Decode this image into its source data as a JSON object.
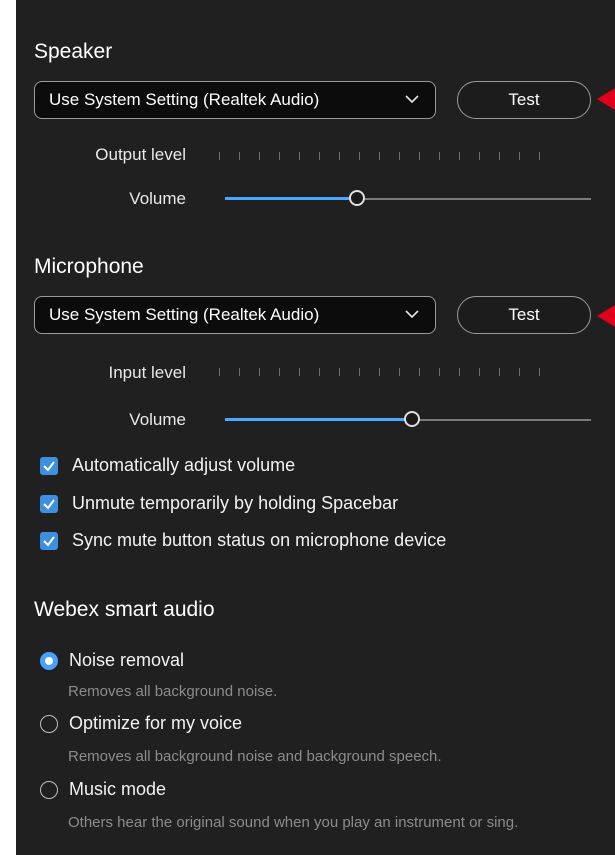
{
  "speaker": {
    "title": "Speaker",
    "device": "Use System Setting (Realtek Audio)",
    "test_label": "Test",
    "output_level_label": "Output level",
    "volume_label": "Volume",
    "volume_fraction": 0.36
  },
  "microphone": {
    "title": "Microphone",
    "device": "Use System Setting (Realtek Audio)",
    "test_label": "Test",
    "input_level_label": "Input level",
    "volume_label": "Volume",
    "volume_fraction": 0.51
  },
  "mic_options": [
    {
      "label": "Automatically adjust volume",
      "checked": true
    },
    {
      "label": "Unmute temporarily by holding Spacebar",
      "checked": true
    },
    {
      "label": "Sync mute button status on microphone device",
      "checked": true
    }
  ],
  "smart_audio": {
    "title": "Webex smart audio",
    "options": [
      {
        "label": "Noise removal",
        "description": "Removes all background noise.",
        "selected": true
      },
      {
        "label": "Optimize for my voice",
        "description": "Removes all background noise and background speech.",
        "selected": false
      },
      {
        "label": "Music mode",
        "description": "Others hear the original sound when you play an instrument or sing.",
        "selected": false
      }
    ]
  },
  "colors": {
    "accent": "#4aa0ff",
    "annotation_arrow": "#e0001b",
    "background": "#202020"
  }
}
